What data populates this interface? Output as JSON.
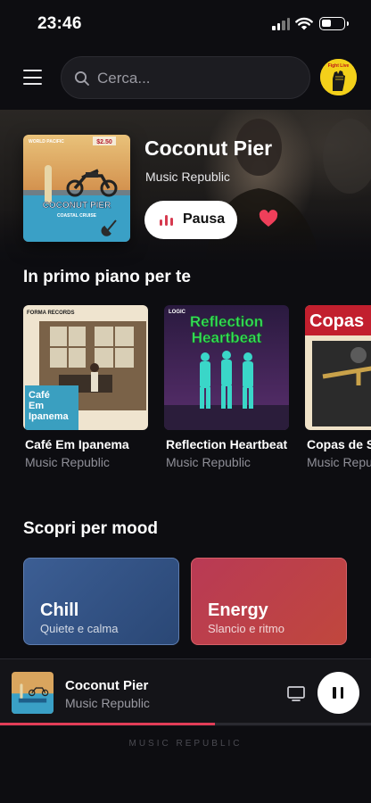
{
  "status_bar": {
    "time": "23:46"
  },
  "top_bar": {
    "search_placeholder": "Cerca...",
    "avatar_text": "Fight Live"
  },
  "hero": {
    "title": "Coconut Pier",
    "artist": "Music Republic",
    "pause_label": "Pausa",
    "art": {
      "top_label": "WORLD PACIFIC",
      "price": "$2.50",
      "title": "COCONUT PIER",
      "subtitle": "COASTAL CRUISE"
    }
  },
  "featured": {
    "heading": "In primo piano per te",
    "cards": [
      {
        "title": "Café Em Ipanema",
        "artist": "Music Republic",
        "art_label": "Café Em Ipanema",
        "art_brand": "FORMA RECORDS"
      },
      {
        "title": "Reflection Heartbeat",
        "artist": "Music Republic",
        "art_label": "Reflection Heartbeat",
        "art_brand": "LOGIC"
      },
      {
        "title": "Copas de Sal",
        "artist": "Music Republic",
        "art_label": "Copas"
      }
    ]
  },
  "moods": {
    "heading": "Scopri per mood",
    "items": [
      {
        "title": "Chill",
        "subtitle": "Quiete e calma",
        "color_from": "#3c5e94",
        "color_to": "#2a4775"
      },
      {
        "title": "Energy",
        "subtitle": "Slancio e ritmo",
        "color_from": "#b93a55",
        "color_to": "#c0473d"
      }
    ]
  },
  "player": {
    "title": "Coconut Pier",
    "artist": "Music Republic",
    "progress": 0.58
  },
  "footer": {
    "brand": "MUSIC REPUBLIC"
  },
  "colors": {
    "accent": "#e23d58",
    "background": "#0d0d11"
  }
}
